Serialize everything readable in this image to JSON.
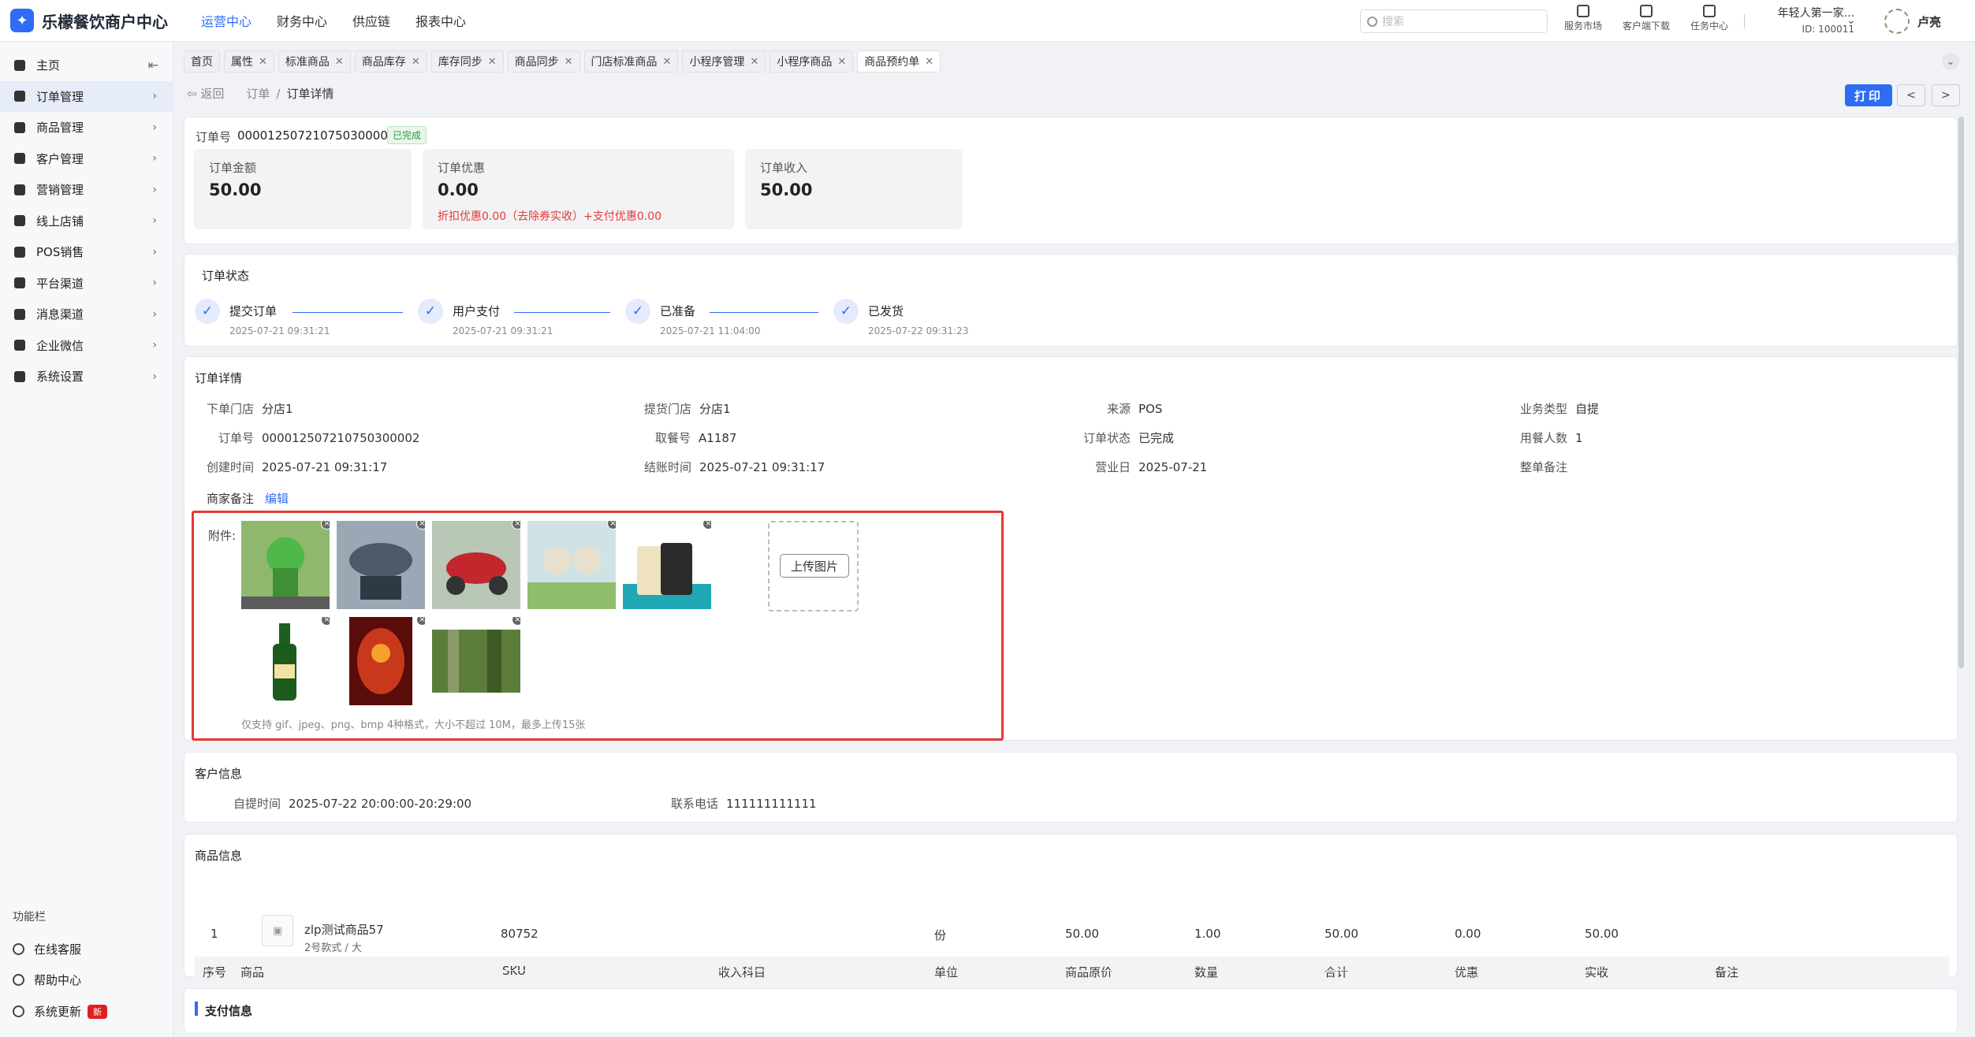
{
  "app": {
    "logo_mark": "✦",
    "title": "乐檬餐饮商户中心"
  },
  "topnav": [
    {
      "label": "运营中心",
      "active": true
    },
    {
      "label": "财务中心",
      "active": false
    },
    {
      "label": "供应链",
      "active": false
    },
    {
      "label": "报表中心",
      "active": false
    }
  ],
  "search": {
    "placeholder": "搜索"
  },
  "tools": [
    {
      "label": "服务市场",
      "icon": "shop-icon"
    },
    {
      "label": "客户端下载",
      "icon": "download-icon"
    },
    {
      "label": "任务中心",
      "icon": "task-icon"
    }
  ],
  "merchant": {
    "name": "年轻人第一家...",
    "id": "ID: 100011"
  },
  "user": {
    "name": "卢亮"
  },
  "sidebar": {
    "items": [
      {
        "label": "主页",
        "icon": "home-icon",
        "active": false
      },
      {
        "label": "订单管理",
        "icon": "order-icon",
        "active": true
      },
      {
        "label": "商品管理",
        "icon": "goods-icon",
        "active": false
      },
      {
        "label": "客户管理",
        "icon": "user-icon",
        "active": false
      },
      {
        "label": "营销管理",
        "icon": "tag-icon",
        "active": false
      },
      {
        "label": "线上店铺",
        "icon": "store-icon",
        "active": false
      },
      {
        "label": "POS销售",
        "icon": "pos-icon",
        "active": false
      },
      {
        "label": "平台渠道",
        "icon": "channel-icon",
        "active": false
      },
      {
        "label": "消息渠道",
        "icon": "message-icon",
        "active": false
      },
      {
        "label": "企业微信",
        "icon": "wechat-icon",
        "active": false
      },
      {
        "label": "系统设置",
        "icon": "gear-icon",
        "active": false
      }
    ],
    "func_title": "功能栏",
    "func_items": [
      {
        "label": "在线客服",
        "icon": "service-icon"
      },
      {
        "label": "帮助中心",
        "icon": "help-icon"
      },
      {
        "label": "系统更新",
        "icon": "refresh-icon",
        "badge": "新"
      }
    ]
  },
  "tabs": [
    {
      "label": "首页",
      "closable": false,
      "active": false
    },
    {
      "label": "属性",
      "closable": true,
      "active": false
    },
    {
      "label": "标准商品",
      "closable": true,
      "active": false
    },
    {
      "label": "商品库存",
      "closable": true,
      "active": false
    },
    {
      "label": "库存同步",
      "closable": true,
      "active": false
    },
    {
      "label": "商品同步",
      "closable": true,
      "active": false
    },
    {
      "label": "门店标准商品",
      "closable": true,
      "active": false
    },
    {
      "label": "小程序管理",
      "closable": true,
      "active": false
    },
    {
      "label": "小程序商品",
      "closable": true,
      "active": false
    },
    {
      "label": "商品预约单",
      "closable": true,
      "active": true
    }
  ],
  "breadcrumb": {
    "back": "返回",
    "parent": "订单",
    "sep": "/",
    "current": "订单详情"
  },
  "actions": {
    "print": "打印",
    "prev": "<",
    "next": ">"
  },
  "summary": {
    "order_label": "订单号",
    "order_no": "000012507210750300002",
    "status": "已完成",
    "stats": [
      {
        "label": "订单金额",
        "value": "50.00",
        "sub": ""
      },
      {
        "label": "订单优惠",
        "value": "0.00",
        "sub": "折扣优惠0.00（去除券实收）+支付优惠0.00"
      },
      {
        "label": "订单收入",
        "value": "50.00",
        "sub": ""
      }
    ]
  },
  "order_status": {
    "title": "订单状态",
    "steps": [
      {
        "name": "提交订单",
        "time": "2025-07-21 09:31:21"
      },
      {
        "name": "用户支付",
        "time": "2025-07-21 09:31:21"
      },
      {
        "name": "已准备",
        "time": "2025-07-21 11:04:00"
      },
      {
        "name": "已发货",
        "time": "2025-07-22 09:31:23"
      }
    ]
  },
  "order_detail": {
    "title": "订单详情",
    "fields": [
      {
        "k": "下单门店",
        "v": "分店1"
      },
      {
        "k": "提货门店",
        "v": "分店1"
      },
      {
        "k": "来源",
        "v": "POS"
      },
      {
        "k": "业务类型",
        "v": "自提"
      },
      {
        "k": "订单号",
        "v": "000012507210750300002"
      },
      {
        "k": "取餐号",
        "v": "A1187"
      },
      {
        "k": "订单状态",
        "v": "已完成"
      },
      {
        "k": "用餐人数",
        "v": "1"
      },
      {
        "k": "创建时间",
        "v": "2025-07-21 09:31:17"
      },
      {
        "k": "结账时间",
        "v": "2025-07-21 09:31:17"
      },
      {
        "k": "营业日",
        "v": "2025-07-21"
      },
      {
        "k": "整单备注",
        "v": ""
      }
    ],
    "remark_label": "商家备注",
    "remark_edit": "编辑",
    "attach_label": "附件:",
    "upload_label": "上传图片",
    "attach_hint": "仅支持 gif、jpeg、png、bmp 4种格式，大小不超过 10M，最多上传15张",
    "remove_mark": "×"
  },
  "customer": {
    "title": "客户信息",
    "pickup_label": "自提时间",
    "pickup_value": "2025-07-22 20:00:00-20:29:00",
    "phone_label": "联系电话",
    "phone_value": "111111111111"
  },
  "products": {
    "title": "商品信息",
    "columns": [
      "序号",
      "商品",
      "SKU",
      "收入科目",
      "单位",
      "商品原价",
      "数量",
      "合计",
      "优惠",
      "实收",
      "备注"
    ],
    "rows": [
      {
        "idx": "1",
        "name": "zlp测试商品57",
        "spec": "2号款式 / 大",
        "sku": "80752",
        "subject": "",
        "unit": "份",
        "price": "50.00",
        "qty": "1.00",
        "total": "50.00",
        "discount": "0.00",
        "received": "50.00",
        "note": ""
      }
    ]
  },
  "payment": {
    "title": "支付信息"
  }
}
